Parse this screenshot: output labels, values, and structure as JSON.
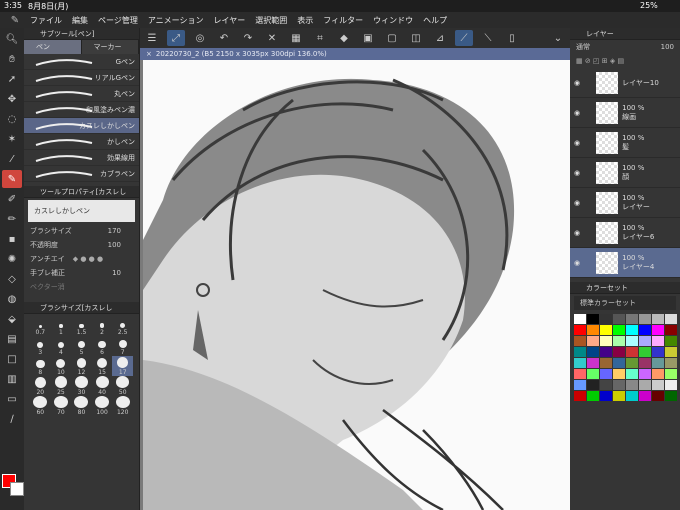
{
  "status": {
    "time": "3:35",
    "date": "8月8日(月)",
    "battery": "25%"
  },
  "menu": [
    "ファイル",
    "編集",
    "ページ管理",
    "アニメーション",
    "レイヤー",
    "選択範囲",
    "表示",
    "フィルター",
    "ウィンドウ",
    "ヘルプ"
  ],
  "document": {
    "tab_title": "20220730_2 (B5 2150 x 3035px 300dpi 136.0%)"
  },
  "subtool": {
    "header": "サブツール[ペン]",
    "tabs": [
      "ペン",
      "マーカー"
    ],
    "brushes": [
      "Gペン",
      "リアルGペン",
      "丸ペン",
      "和風塗みペン濃",
      "カスレしかしペン",
      "かしペン",
      "効果線用",
      "カブラペン"
    ],
    "selected_index": 4
  },
  "toolprop": {
    "header": "ツールプロパティ[カスレし",
    "brush_name": "カスレしかしペン",
    "size_label": "ブラシサイズ",
    "size_value": "170",
    "opacity_label": "不透明度",
    "opacity_value": "100",
    "aa_label": "アンチエイ",
    "stab_label": "手ブレ補正",
    "stab_value": "10",
    "vector_label": "ベクター消"
  },
  "brushsize": {
    "header": "ブラシサイズ[カスレし",
    "sizes": [
      "0.7",
      "1",
      "1.5",
      "2",
      "2.5",
      "3",
      "4",
      "5",
      "6",
      "7",
      "8",
      "10",
      "12",
      "15",
      "17",
      "20",
      "25",
      "30",
      "40",
      "50",
      "60",
      "70",
      "80",
      "100",
      "120"
    ],
    "selected": "17"
  },
  "layers": {
    "tabs": [
      "レイヤー"
    ],
    "blend": "通常",
    "opacity": "100",
    "items": [
      {
        "name": "レイヤー10",
        "pct": "",
        "sel": false
      },
      {
        "name": "線画",
        "pct": "100 %",
        "sel": false
      },
      {
        "name": "髪",
        "pct": "100 %",
        "sel": false
      },
      {
        "name": "顔",
        "pct": "100 %",
        "sel": false
      },
      {
        "name": "レイヤー",
        "pct": "100 %",
        "sel": false
      },
      {
        "name": "レイヤー6",
        "pct": "100 %",
        "sel": false
      },
      {
        "name": "レイヤー4",
        "pct": "100 %",
        "sel": true
      }
    ]
  },
  "colorset": {
    "header": "カラーセット",
    "name": "標準カラーセット"
  },
  "colors": {
    "foreground": "#ff0000",
    "background": "#ffffff",
    "accent": "#5a6a90"
  }
}
